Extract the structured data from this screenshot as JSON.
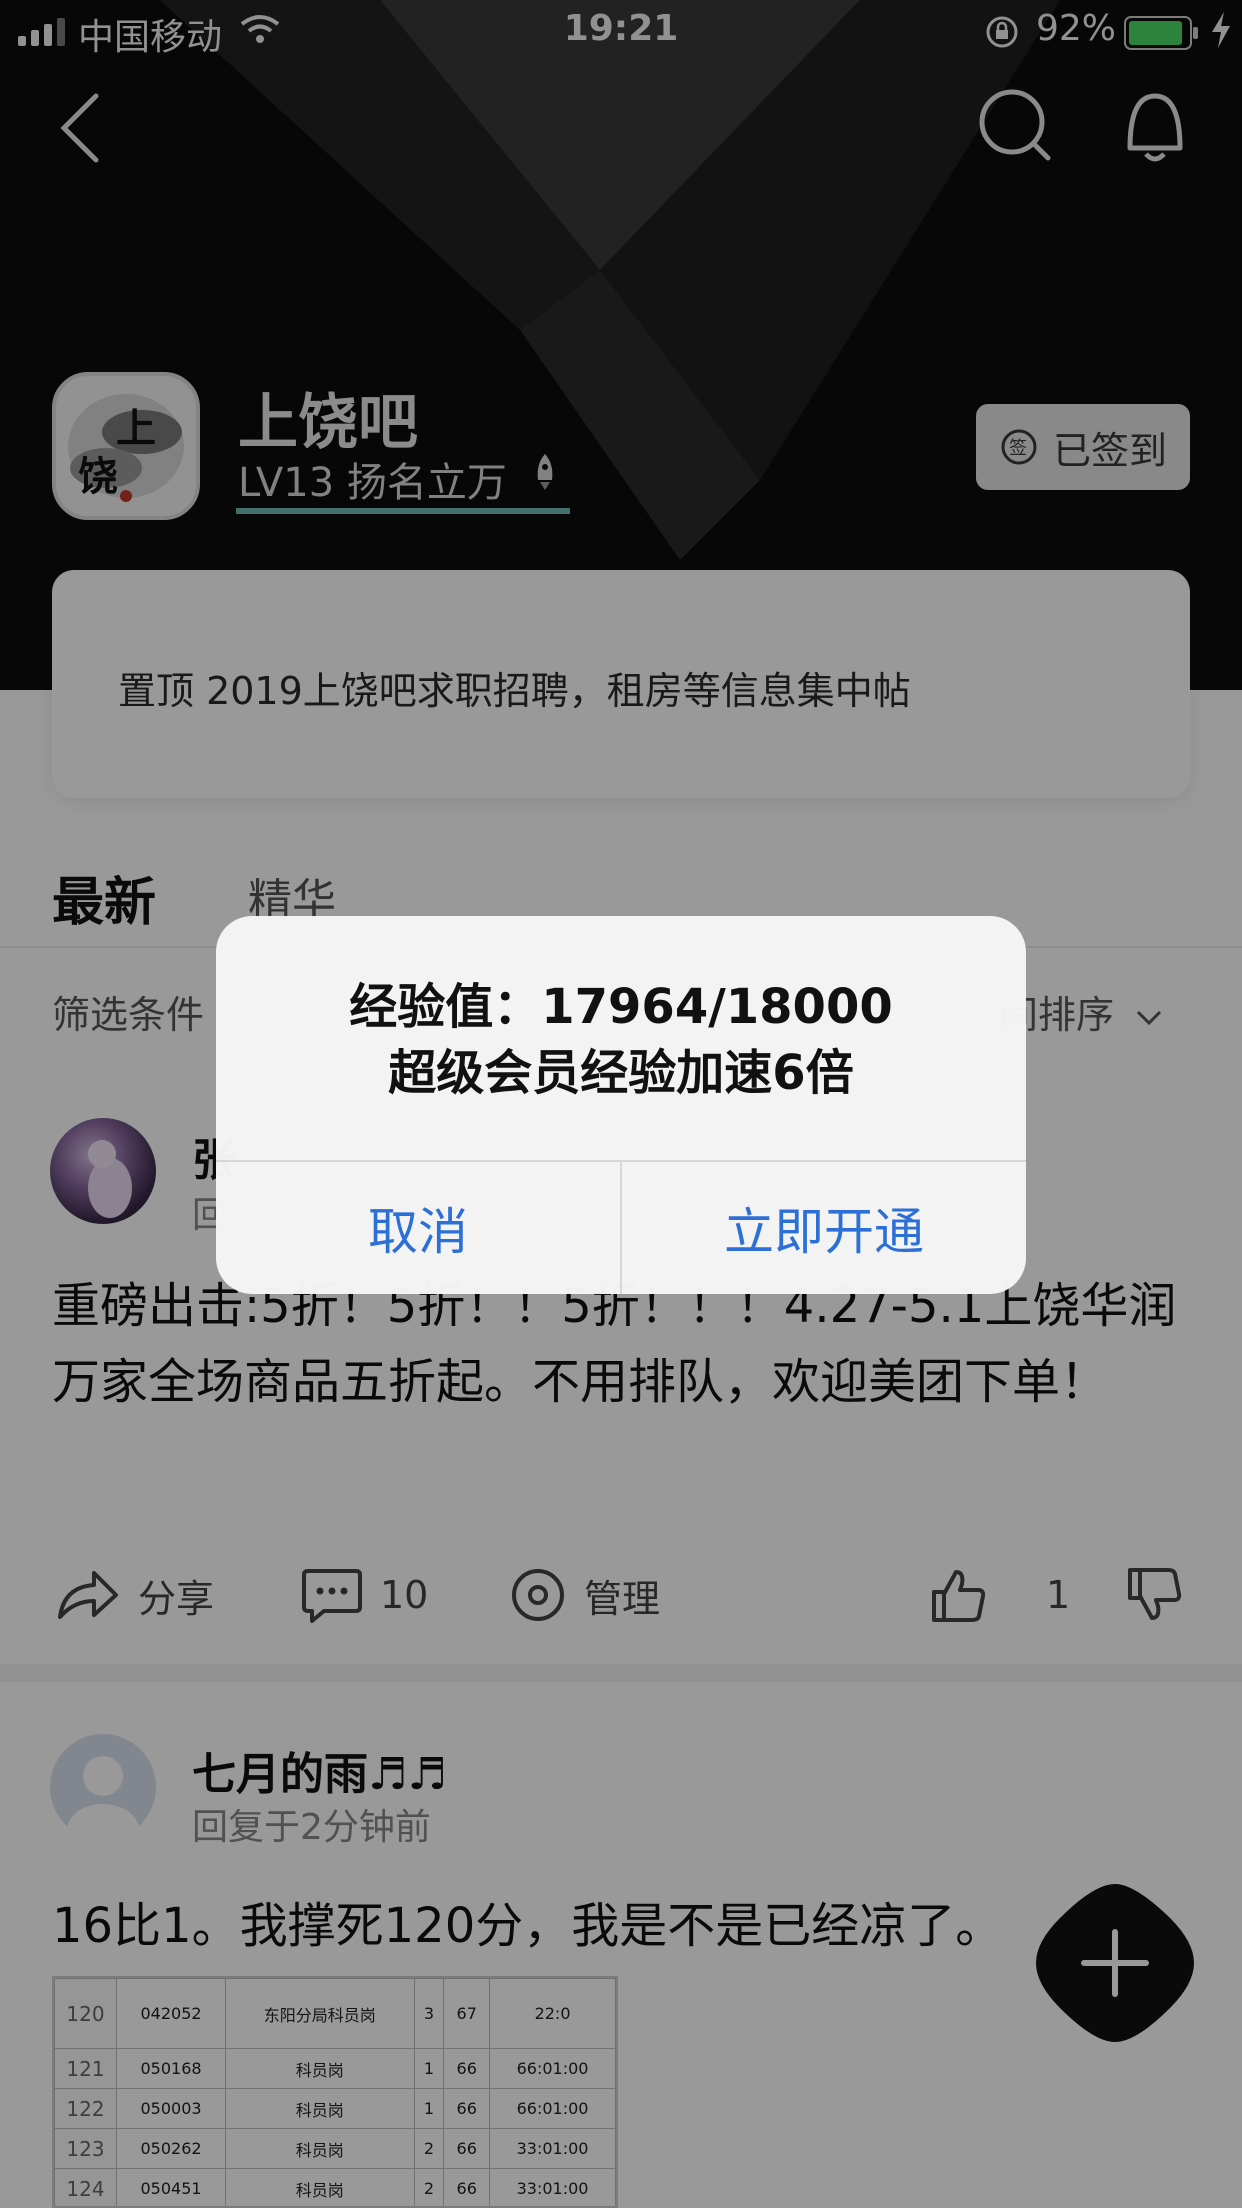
{
  "status_bar": {
    "carrier": "中国移动",
    "time": "19:21",
    "battery": "92%",
    "battery_level": 0.92
  },
  "forum": {
    "name": "上饶吧",
    "level": "LV13 扬名立万",
    "avatar_text": [
      "上",
      "饶"
    ],
    "signed_label": "已签到",
    "signed_icon_text": "签"
  },
  "pinned": {
    "text": "置顶   2019上饶吧求职招聘，租房等信息集中帖"
  },
  "tabs": {
    "newest": "最新",
    "featured": "精华"
  },
  "filter": {
    "label": "筛选条件",
    "sort_label": "间排序"
  },
  "posts": [
    {
      "author": "张",
      "time": "回",
      "body": "重磅出击:5折！5折！！5折！！！4.27-5.1上饶华润万家全场商品五折起。不用排队，欢迎美团下单！",
      "actions": {
        "share": "分享",
        "comments": "10",
        "manage": "管理",
        "likes": "1"
      }
    },
    {
      "author": "七月的雨♬♬",
      "time": "回复于2分钟前",
      "body": "16比1。我撑死120分，我是不是已经凉了。",
      "image_table": [
        [
          "120",
          "042052",
          "东阳分局科员岗",
          "3",
          "67",
          "22:0"
        ],
        [
          "121",
          "050168",
          "科员岗",
          "1",
          "66",
          "66:01:00"
        ],
        [
          "122",
          "050003",
          "科员岗",
          "1",
          "66",
          "66:01:00"
        ],
        [
          "123",
          "050262",
          "科员岗",
          "2",
          "66",
          "33:01:00"
        ],
        [
          "124",
          "050451",
          "科员岗",
          "2",
          "66",
          "33:01:00"
        ]
      ]
    }
  ],
  "dialog": {
    "title": "经验值：17964/18000",
    "subtitle": "超级会员经验加速6倍",
    "cancel": "取消",
    "confirm": "立即开通"
  },
  "colors": {
    "header_bg": "#0d0d0d",
    "level_underline": "#6fb8b4",
    "dialog_button": "#2c6fd6",
    "fab_bg": "#111111"
  },
  "icons": [
    "signal-icon",
    "wifi-icon",
    "lock-rotation-icon",
    "battery-icon",
    "charging-icon",
    "back-icon",
    "search-icon",
    "bell-icon",
    "rocket-icon",
    "sign-in-icon",
    "chevron-down-icon",
    "share-icon",
    "comment-icon",
    "manage-icon",
    "thumbs-up-icon",
    "thumbs-down-icon",
    "plus-icon"
  ]
}
